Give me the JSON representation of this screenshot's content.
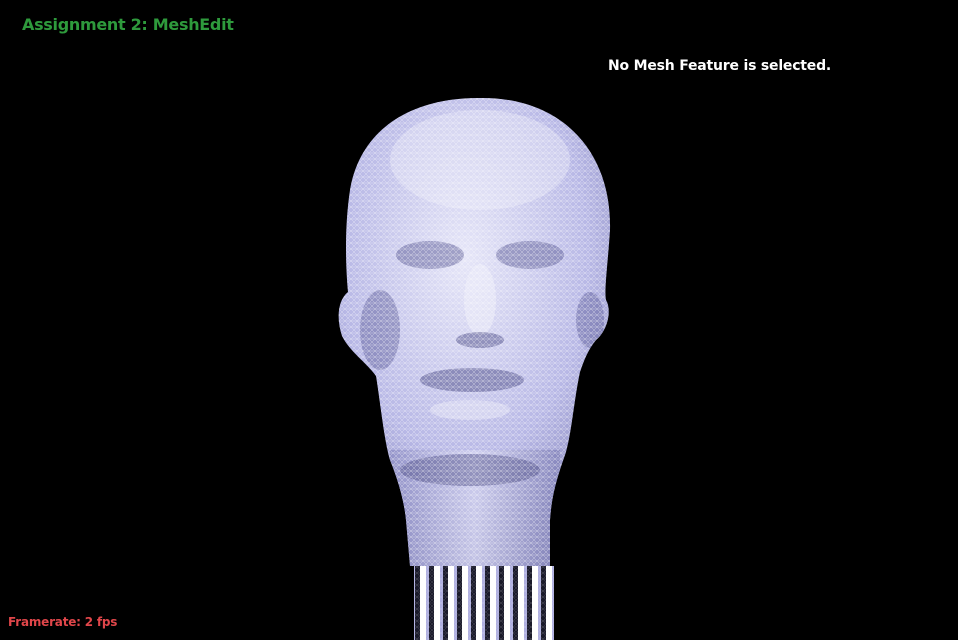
{
  "app": {
    "title": "Assignment 2: MeshEdit"
  },
  "status": {
    "selection_message": "No Mesh Feature is selected.",
    "framerate_label": "Framerate: 2 fps"
  },
  "colors": {
    "background": "#000000",
    "title": "#2e9a3c",
    "selection_message": "#ffffff",
    "framerate": "#e0464a",
    "mesh_fill": "#b4b4e8",
    "mesh_wire": "#ffffff",
    "mesh_shadow": "#6e6ea8"
  },
  "viewport": {
    "content": "3D head mesh",
    "render_mode": "wireframe over shaded surface",
    "icon": "mesh-head-icon"
  }
}
